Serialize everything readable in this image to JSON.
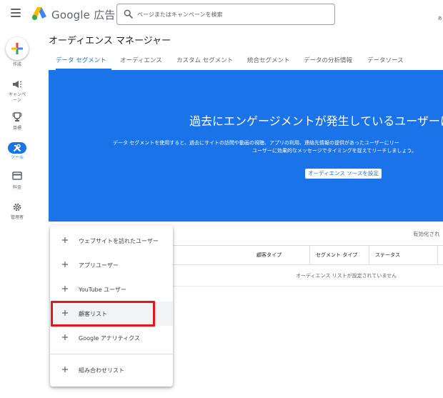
{
  "app": {
    "brand": "Google 広告",
    "corner_char": "ぁ"
  },
  "search": {
    "placeholder": "ページまたはキャンペーンを検索",
    "value": ""
  },
  "rail": {
    "create_label": "作成",
    "campaign_label": "キャンペーン",
    "goals_label": "目標",
    "tools_label": "ツール",
    "billing_label": "料金",
    "admin_label": "管理者"
  },
  "header": {
    "title": "オーディエンス マネージャー",
    "tabs": [
      {
        "label": "データ セグメント",
        "active": true
      },
      {
        "label": "オーディエンス",
        "active": false
      },
      {
        "label": "カスタム セグメント",
        "active": false
      },
      {
        "label": "統合セグメント",
        "active": false
      },
      {
        "label": "データの分析情報",
        "active": false
      },
      {
        "label": "データソース",
        "active": false
      }
    ]
  },
  "banner": {
    "title": "過去にエンゲージメントが発生しているユーザーに",
    "text_line1": "データ セグメントを使用すると、過去にサイトの訪問や動画の視聴、アプリの利用、連絡先情報の提供があったユーザーにリー",
    "text_line2": "ユーザーに効果的なメッセージでタイミングを捉えてリーチしましょう。",
    "button_label": "オーディエンス ソースを設定",
    "bg_color": "#1a73e8"
  },
  "table": {
    "enabled_label": "有効化され",
    "columns": [
      "顧客タイプ",
      "セグメント タイプ",
      "ステータス"
    ],
    "empty_message": "オーディエンス リストが設定されていません"
  },
  "menu": {
    "items": [
      {
        "label": "ウェブサイトを訪れたユーザー",
        "selected": false
      },
      {
        "label": "アプリユーザー",
        "selected": false
      },
      {
        "label": "YouTube ユーザー",
        "selected": false
      },
      {
        "label": "顧客リスト",
        "selected": true
      },
      {
        "label": "Google アナリティクス",
        "selected": false
      },
      {
        "label": "組み合わせリスト",
        "selected": false
      }
    ],
    "highlight_color": "#e8141c"
  }
}
